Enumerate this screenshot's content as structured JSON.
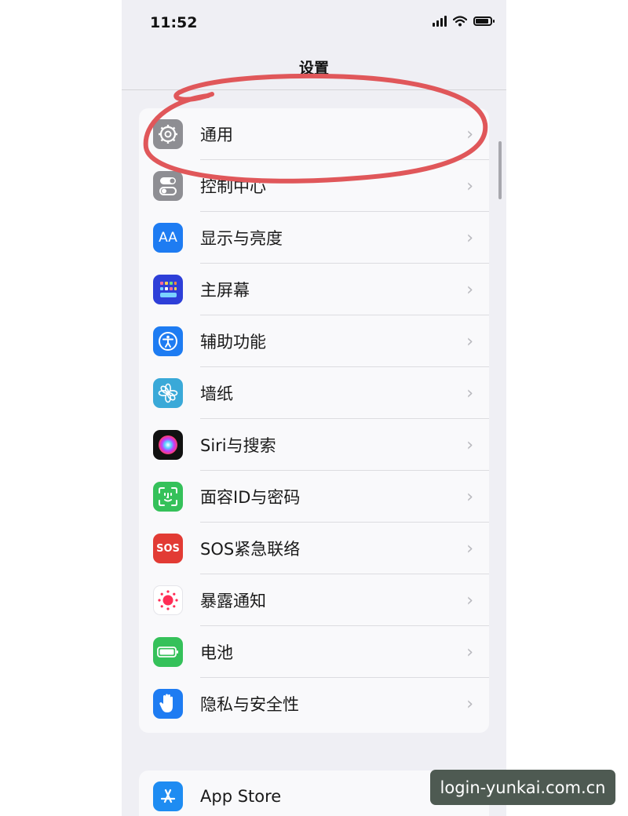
{
  "status_bar": {
    "time": "11:52"
  },
  "nav": {
    "title": "设置"
  },
  "settings_items": [
    {
      "label": "通用",
      "icon": "gear-icon",
      "color": "#8e8e93"
    },
    {
      "label": "控制中心",
      "icon": "toggles-icon",
      "color": "#8e8e93"
    },
    {
      "label": "显示与亮度",
      "icon": "aa-icon",
      "icon_text": "AA",
      "color": "#1e7cf2"
    },
    {
      "label": "主屏幕",
      "icon": "home-grid-icon",
      "color": "#2e3fd8"
    },
    {
      "label": "辅助功能",
      "icon": "accessibility-icon",
      "color": "#1e7cf2"
    },
    {
      "label": "墙纸",
      "icon": "wallpaper-flower-icon",
      "color": "#3aa9d8"
    },
    {
      "label": "Siri与搜索",
      "icon": "siri-icon",
      "color": "#111111"
    },
    {
      "label": "面容ID与密码",
      "icon": "face-id-icon",
      "color": "#35c15a"
    },
    {
      "label": "SOS紧急联络",
      "icon": "sos-icon",
      "icon_text": "SOS",
      "color": "#e23b34"
    },
    {
      "label": "暴露通知",
      "icon": "exposure-icon",
      "color": "#ffffff"
    },
    {
      "label": "电池",
      "icon": "battery-icon",
      "color": "#35c15a"
    },
    {
      "label": "隐私与安全性",
      "icon": "hand-icon",
      "color": "#1e7cf2"
    }
  ],
  "second_group": [
    {
      "label": "App Store",
      "icon": "app-store-icon",
      "color": "#1e8cf2"
    }
  ],
  "watermark": "login-yunkai.com.cn",
  "annotation": {
    "color": "#e0575a"
  }
}
